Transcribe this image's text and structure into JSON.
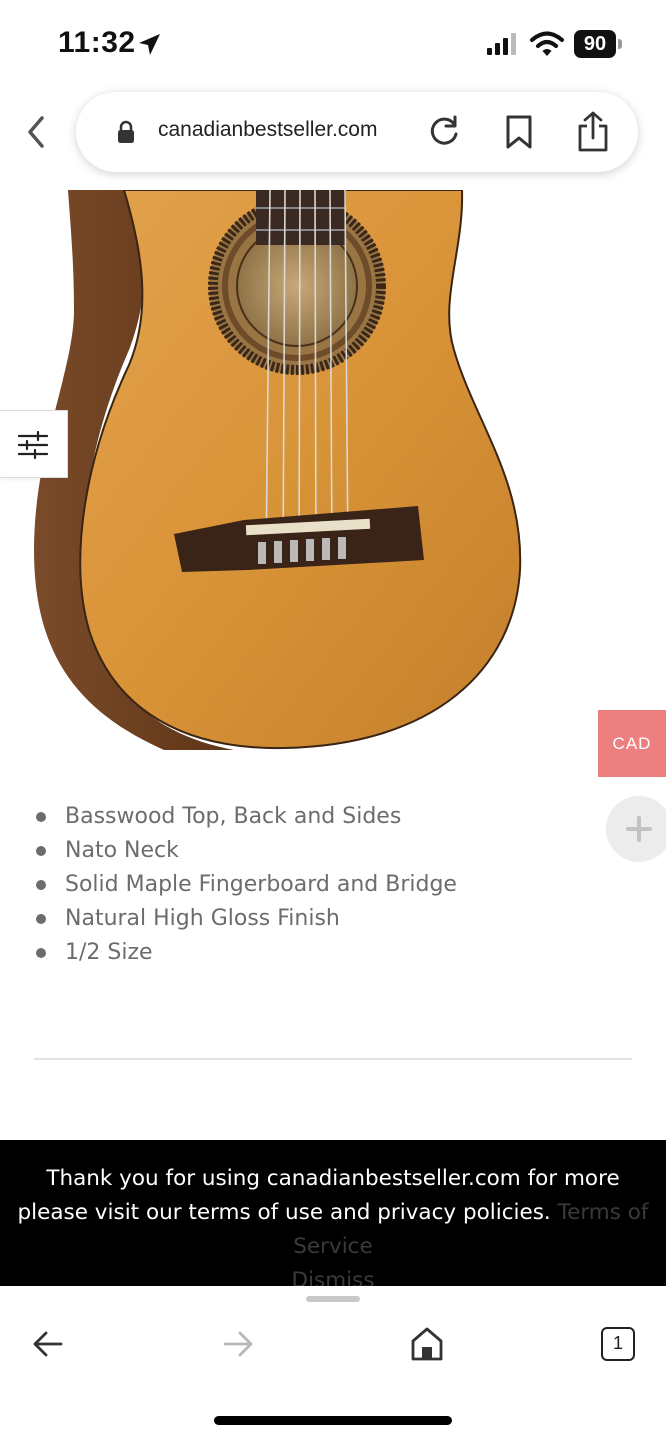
{
  "status_bar": {
    "time": "11:32",
    "battery": "90"
  },
  "browser": {
    "url": "canadianbestseller.com"
  },
  "product": {
    "image_icon": "guitar-image",
    "features": [
      "Basswood Top, Back and Sides",
      "Nato Neck",
      "Solid Maple Fingerboard and Bridge",
      "Natural High Gloss Finish",
      "1/2 Size"
    ]
  },
  "currency_tab": {
    "label": "CAD",
    "color": "#ec7f80"
  },
  "cookie_banner": {
    "message": "Thank you for using canadianbestseller.com for more please visit our terms of use and privacy policies.",
    "terms_link": "Terms of Service",
    "dismiss_link": "Dismiss"
  },
  "toolbar": {
    "tab_count": "1"
  },
  "icons": {
    "status": [
      "location-arrow-icon",
      "signal-icon",
      "wifi-icon",
      "battery-icon"
    ],
    "browser": [
      "back-chevron-icon",
      "lock-icon",
      "reload-icon",
      "bookmark-icon",
      "share-icon"
    ],
    "toolbar": [
      "back-arrow-icon",
      "forward-arrow-icon",
      "home-icon",
      "tabs-icon"
    ],
    "floating": [
      "filter-sliders-icon",
      "plus-icon"
    ]
  }
}
